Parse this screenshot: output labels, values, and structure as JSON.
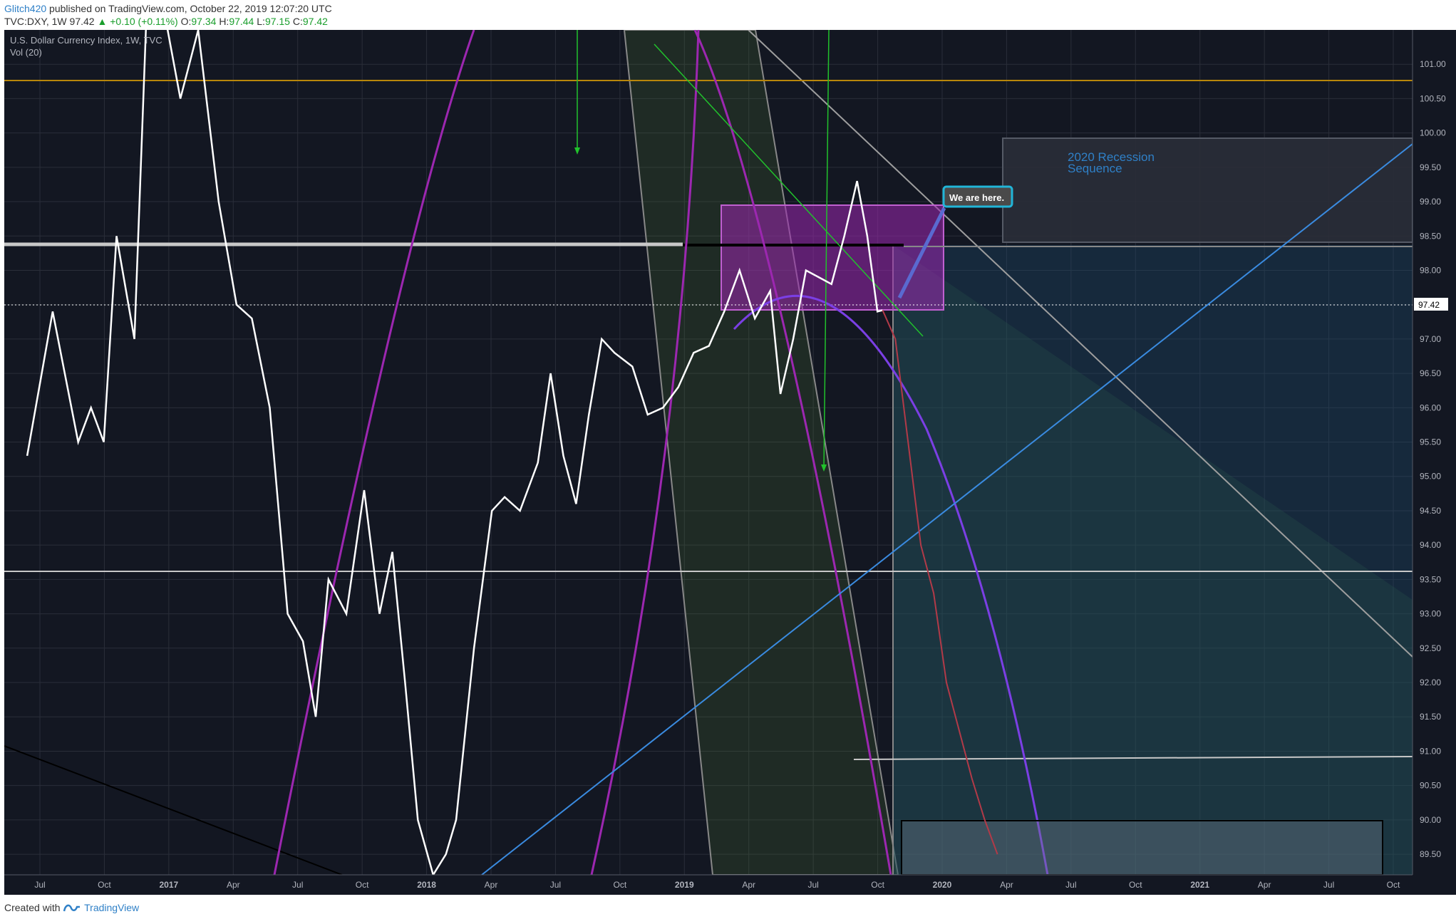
{
  "header": {
    "author": "Glitch420",
    "published_text": "published on TradingView.com, October 22, 2019 12:07:20 UTC",
    "symbol": "TVC:DXY, 1W",
    "last": "97.42",
    "change": "▲ +0.10 (+0.11%)",
    "ohlc": {
      "o_label": "O:",
      "o": "97.34",
      "h_label": "H:",
      "h": "97.44",
      "l_label": "L:",
      "l": "97.15",
      "c_label": "C:",
      "c": "97.42"
    }
  },
  "legend": {
    "title": "U.S. Dollar Currency Index, 1W, TVC",
    "volume": "Vol (20)"
  },
  "annotations": {
    "recession_line1": "2020 Recession",
    "recession_line2": "Sequence",
    "callout": "We are here."
  },
  "footer": {
    "created_with": "Created with",
    "brand": "TradingView"
  },
  "colors": {
    "background": "#131722",
    "price_line": "#ffffff",
    "projection_line": "#b23a48",
    "purple_box": "#9c27b0",
    "accent_blue": "#2f80c7",
    "green_arrow": "#21c22c",
    "parabola": "#8e24e0"
  },
  "chart_data": {
    "type": "line",
    "series_label": "U.S. Dollar Currency Index, 1W, TVC",
    "last_price_label": "97.42",
    "y_ticks": [
      "101.00",
      "100.50",
      "100.00",
      "99.50",
      "99.00",
      "98.50",
      "98.00",
      "97.50",
      "97.00",
      "96.50",
      "96.00",
      "95.50",
      "95.00",
      "94.50",
      "94.00",
      "93.50",
      "93.00",
      "92.50",
      "92.00",
      "91.50",
      "91.00",
      "90.50",
      "90.00",
      "89.50"
    ],
    "x_ticks": [
      "Jul",
      "Oct",
      "2017",
      "Apr",
      "Jul",
      "Oct",
      "2018",
      "Apr",
      "Jul",
      "Oct",
      "2019",
      "Apr",
      "Jul",
      "Oct",
      "2020",
      "Apr",
      "Jul",
      "Oct",
      "2021",
      "Apr",
      "Jul",
      "Oct"
    ],
    "ylim": [
      89.2,
      101.5
    ],
    "x": [
      2016.45,
      2016.55,
      2016.65,
      2016.7,
      2016.75,
      2016.8,
      2016.87,
      2016.92,
      2017.0,
      2017.05,
      2017.12,
      2017.2,
      2017.27,
      2017.33,
      2017.4,
      2017.47,
      2017.53,
      2017.58,
      2017.63,
      2017.7,
      2017.77,
      2017.83,
      2017.88,
      2017.93,
      2017.98,
      2018.04,
      2018.09,
      2018.13,
      2018.2,
      2018.27,
      2018.32,
      2018.38,
      2018.45,
      2018.5,
      2018.55,
      2018.6,
      2018.65,
      2018.7,
      2018.75,
      2018.82,
      2018.88,
      2018.94,
      2019.0,
      2019.06,
      2019.12,
      2019.18,
      2019.24,
      2019.3,
      2019.36,
      2019.4,
      2019.45,
      2019.5,
      2019.55,
      2019.6,
      2019.65,
      2019.7,
      2019.74,
      2019.78,
      2019.8
    ],
    "y": [
      95.3,
      97.4,
      95.5,
      96.0,
      95.5,
      98.5,
      97.0,
      102.0,
      101.5,
      100.5,
      101.5,
      99.0,
      97.5,
      97.3,
      96.0,
      93.0,
      92.6,
      91.5,
      93.5,
      93.0,
      94.8,
      93.0,
      93.9,
      92.0,
      90.0,
      89.2,
      89.5,
      90.0,
      92.5,
      94.5,
      94.7,
      94.5,
      95.2,
      96.5,
      95.3,
      94.6,
      95.9,
      97.0,
      96.8,
      96.6,
      95.9,
      96.0,
      96.3,
      96.8,
      96.9,
      97.4,
      98.0,
      97.3,
      97.7,
      96.2,
      97.0,
      98.0,
      97.9,
      97.8,
      98.5,
      99.3,
      98.5,
      97.4,
      97.42
    ],
    "projection_x": [
      2019.8,
      2019.85,
      2019.9,
      2019.95,
      2020.0,
      2020.05,
      2020.1,
      2020.15,
      2020.2,
      2020.25
    ],
    "projection_y": [
      97.42,
      97.0,
      95.5,
      94.0,
      93.3,
      92.0,
      91.3,
      90.6,
      90.0,
      89.5
    ],
    "horizontal_levels": [
      100.7,
      98.3,
      97.42,
      93.55,
      90.8
    ]
  }
}
